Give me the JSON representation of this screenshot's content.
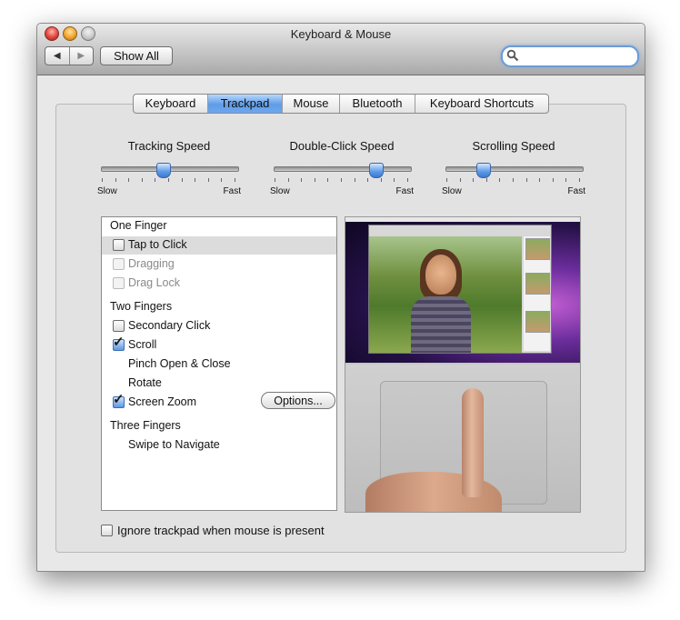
{
  "window": {
    "title": "Keyboard & Mouse"
  },
  "toolbar": {
    "back_label": "◀",
    "forward_label": "▶",
    "show_all_label": "Show All",
    "search_placeholder": "",
    "search_value": ""
  },
  "tabs": [
    {
      "label": "Keyboard",
      "active": false
    },
    {
      "label": "Trackpad",
      "active": true
    },
    {
      "label": "Mouse",
      "active": false
    },
    {
      "label": "Bluetooth",
      "active": false
    },
    {
      "label": "Keyboard Shortcuts",
      "active": false
    }
  ],
  "sliders": [
    {
      "label": "Tracking Speed",
      "min_label": "Slow",
      "max_label": "Fast",
      "value": 0.45
    },
    {
      "label": "Double-Click Speed",
      "min_label": "Slow",
      "max_label": "Fast",
      "value": 0.77
    },
    {
      "label": "Scrolling Speed",
      "min_label": "Slow",
      "max_label": "Fast",
      "value": 0.25
    }
  ],
  "gestures": {
    "one_finger": {
      "heading": "One Finger",
      "tap_to_click": "Tap to Click",
      "dragging": "Dragging",
      "drag_lock": "Drag Lock"
    },
    "two_fingers": {
      "heading": "Two Fingers",
      "secondary_click": "Secondary Click",
      "scroll": "Scroll",
      "pinch": "Pinch Open & Close",
      "rotate": "Rotate",
      "screen_zoom": "Screen Zoom",
      "options_label": "Options..."
    },
    "three_fingers": {
      "heading": "Three Fingers",
      "swipe": "Swipe to Navigate"
    }
  },
  "ignore_trackpad_label": "Ignore trackpad when mouse is present",
  "colors": {
    "tab_active": "#5f9ce8",
    "accent": "#3d7ad0"
  }
}
